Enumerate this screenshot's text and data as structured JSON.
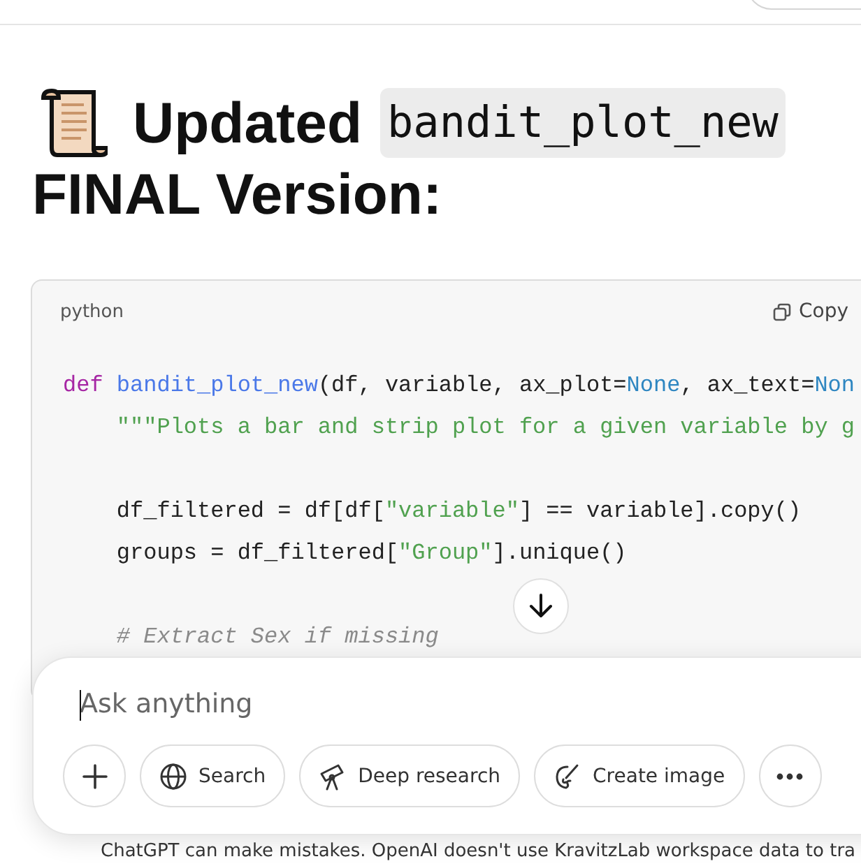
{
  "heading": {
    "text": "Updated",
    "code": "bandit_plot_new",
    "line2": "FINAL Version:"
  },
  "code_block": {
    "language": "python",
    "copy_label": "Copy",
    "lines": [
      {
        "kind": "code",
        "tokens": [
          {
            "kind": "keyword",
            "text": "def "
          },
          {
            "kind": "function",
            "text": "bandit_plot_new"
          },
          {
            "kind": "plain",
            "text": "(df, variable, ax_plot="
          },
          {
            "kind": "constant",
            "text": "None"
          },
          {
            "kind": "plain",
            "text": ", ax_text="
          },
          {
            "kind": "constant",
            "text": "Non"
          }
        ]
      },
      {
        "kind": "code",
        "tokens": [
          {
            "kind": "string",
            "text": "    \"\"\"Plots a bar and strip plot for a given variable by g"
          }
        ]
      },
      {
        "kind": "blank"
      },
      {
        "kind": "code",
        "tokens": [
          {
            "kind": "plain",
            "text": "    df_filtered = df[df["
          },
          {
            "kind": "string",
            "text": "\"variable\""
          },
          {
            "kind": "plain",
            "text": "] == variable].copy()"
          }
        ]
      },
      {
        "kind": "code",
        "tokens": [
          {
            "kind": "plain",
            "text": "    groups = df_filtered["
          },
          {
            "kind": "string",
            "text": "\"Group\""
          },
          {
            "kind": "plain",
            "text": "].unique()"
          }
        ]
      },
      {
        "kind": "blank"
      },
      {
        "kind": "code",
        "tokens": [
          {
            "kind": "comment",
            "text": "    # Extract Sex if missing"
          }
        ]
      }
    ]
  },
  "composer": {
    "placeholder": "Ask anything",
    "buttons": [
      {
        "kind": "plus"
      },
      {
        "kind": "search",
        "label": "Search"
      },
      {
        "kind": "research",
        "label": "Deep research"
      },
      {
        "kind": "image",
        "label": "Create image"
      },
      {
        "kind": "more"
      }
    ]
  },
  "disclaimer": "ChatGPT can make mistakes. OpenAI doesn't use KravitzLab workspace data to tra"
}
